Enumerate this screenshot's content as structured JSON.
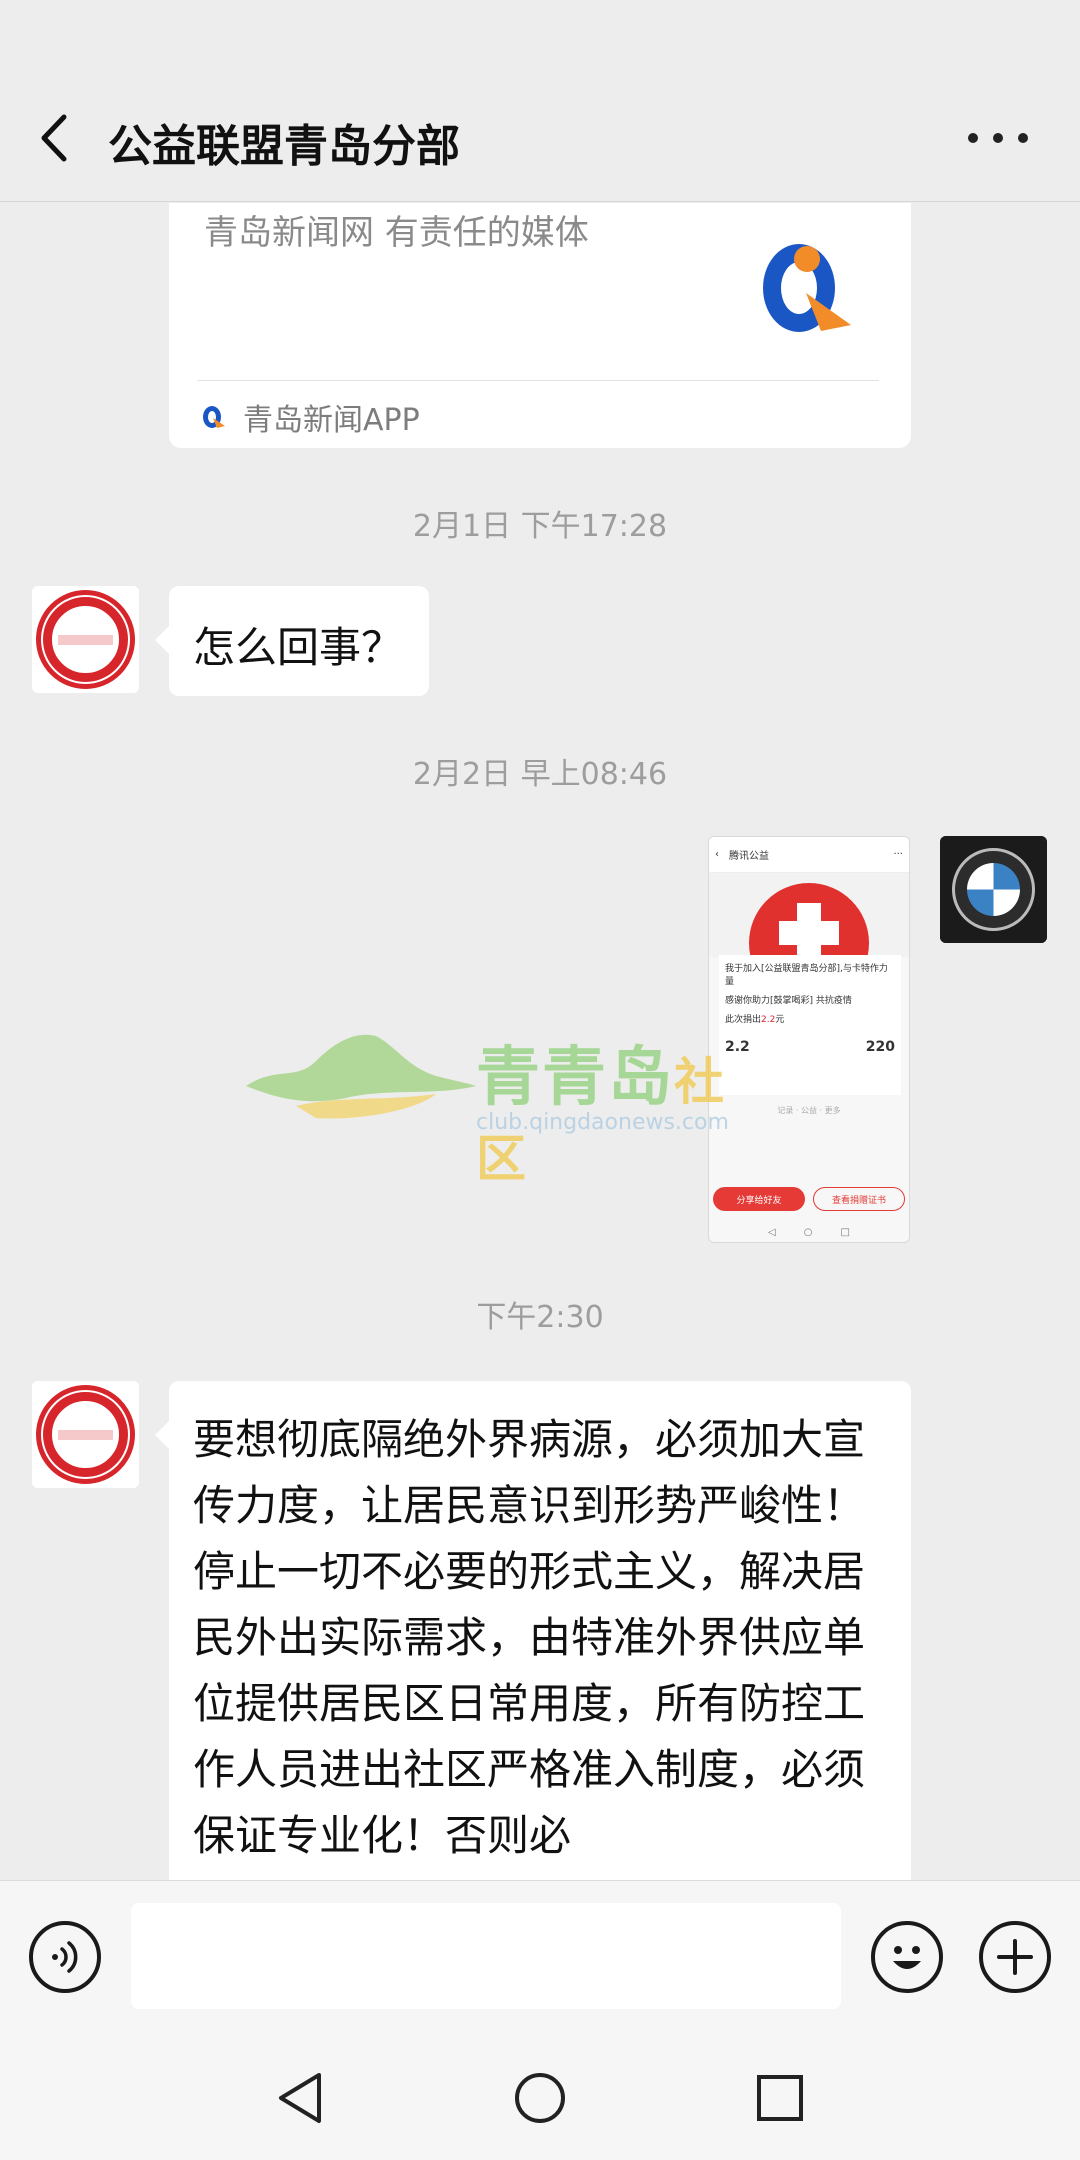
{
  "header": {
    "title": "公益联盟青岛分部"
  },
  "link_card": {
    "description": "青岛新闻网 有责任的媒体",
    "source": "青岛新闻APP"
  },
  "messages": {
    "ts1": "2月1日 下午17:28",
    "msg1": "怎么回事？",
    "ts2": "2月2日 早上08:46",
    "ts3": "下午2:30",
    "msg2": "要想彻底隔绝外界病源，必须加大宣传力度，让居民意识到形势严峻性！停止一切不必要的形式主义，解决居民外出实际需求，由特准外界供应单位提供居民区日常用度，所有防控工作人员进出社区严格准入制度，必须保证专业化！否则必"
  },
  "screenshot_msg": {
    "top_title": "腾讯公益",
    "card_line1": "我于加入[公益联盟青岛分部],与卡特作力量",
    "card_line2": "感谢你助力[鼓掌喝彩] 共抗疫情",
    "card_line3_prefix": "此次捐出",
    "card_line3_amount": "2.2",
    "card_line3_suffix": "元",
    "stat_left": "2.2",
    "stat_right": "220",
    "foot_note": "记录 · 公益 · 更多",
    "btn_left": "分享给好友",
    "btn_right": "查看捐赠证书"
  },
  "watermark": {
    "brand_main": "青青岛",
    "brand_sub": "社区",
    "url": "club.qingdaonews.com"
  },
  "input": {
    "value": "",
    "placeholder": ""
  },
  "icons": {
    "back": "back-arrow-icon",
    "more": "more-dots-icon",
    "voice": "voice-icon",
    "emoji": "emoji-icon",
    "plus": "plus-icon"
  }
}
